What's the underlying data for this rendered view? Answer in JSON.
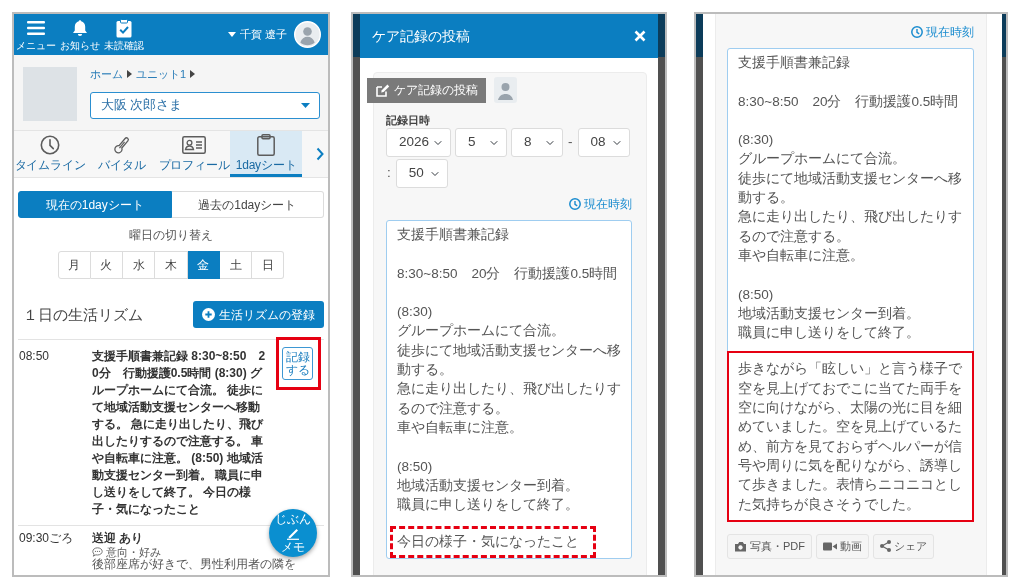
{
  "sheet_screen": {
    "header": {
      "nav_items": [
        {
          "kind": "menu",
          "label": "メニュー"
        },
        {
          "kind": "bell",
          "label": "お知らせ"
        },
        {
          "kind": "unread",
          "label": "未読確認"
        }
      ],
      "user_name": "千賀 遼子"
    },
    "breadcrumb": [
      "ホーム",
      "ユニット1"
    ],
    "resident_select": {
      "value": "大阪 次郎さま"
    },
    "tabs": [
      {
        "kind": "timeline",
        "label": "タイムライン",
        "selected": false
      },
      {
        "kind": "vital",
        "label": "バイタル",
        "selected": false
      },
      {
        "kind": "profile",
        "label": "プロフィール",
        "selected": false
      },
      {
        "kind": "sheet",
        "label": "1dayシート",
        "selected": true
      }
    ],
    "sheet_toggle": [
      {
        "label": "現在の1dayシート",
        "selected": true
      },
      {
        "label": "過去の1dayシート",
        "selected": false
      }
    ],
    "weekday_title": "曜日の切り替え",
    "weekdays": [
      {
        "label": "月",
        "selected": false
      },
      {
        "label": "火",
        "selected": false
      },
      {
        "label": "水",
        "selected": false
      },
      {
        "label": "木",
        "selected": false
      },
      {
        "label": "金",
        "selected": true
      },
      {
        "label": "土",
        "selected": false
      },
      {
        "label": "日",
        "selected": false
      }
    ],
    "section_title": "１日の生活リズム",
    "add_button": "生活リズムの登録",
    "rows": [
      {
        "time": "08:50",
        "title": "支援手順書兼記録 8:30~8:50　20分　行動援護0.5時間 (8:30) グループホームにて合流。 徒歩にて地域活動支援センターへ移動する。 急に走り出したり、飛び出したりするので注意する。 車や自転車に注意。 (8:50) 地域活動支援センター到着。 職員に申し送りをして終了。 今日の様子・気になったこと",
        "record_button": "記録する",
        "highlighted": true
      },
      {
        "time": "09:30ごろ",
        "title": "送迎 あり",
        "note_label": "意向・好み",
        "note": "後部座席が好きで、男性利用者の隣を",
        "highlighted": false
      }
    ],
    "memo_button": {
      "top_text": "じぶん",
      "bottom_text": "メモ"
    }
  },
  "post_screen": {
    "modal_title": "ケア記録の投稿",
    "post_tab": "ケア記録の投稿",
    "datetime_label": "記録日時",
    "datetime_parts": [
      {
        "kind": "select",
        "value": "2026"
      },
      {
        "kind": "select",
        "value": "5"
      },
      {
        "kind": "select",
        "value": "8"
      },
      {
        "kind": "separator",
        "text": "-"
      },
      {
        "kind": "select",
        "value": "08"
      },
      {
        "kind": "separator",
        "text": ":"
      },
      {
        "kind": "select",
        "value": "50"
      }
    ],
    "now_link": "現在時刻",
    "textarea": {
      "paragraphs": [
        [
          "支援手順書兼記録"
        ],
        [
          "8:30~8:50　20分　行動援護0.5時間"
        ],
        [
          "(8:30)",
          "グループホームにて合流。",
          "徒歩にて地域活動支援センターへ移動する。",
          "急に走り出したり、飛び出したりするので注意する。",
          "車や自転車に注意。"
        ],
        [
          "(8:50)",
          "地域活動支援センター到着。",
          "職員に申し送りをして終了。"
        ]
      ],
      "note": {
        "text": "今日の様子・気になったこと",
        "dashed": true
      }
    }
  },
  "post_screen_scrolled": {
    "now_link": "現在時刻",
    "textarea": {
      "paragraphs": [
        [
          "支援手順書兼記録"
        ],
        [
          "8:30~8:50　20分　行動援護0.5時間"
        ],
        [
          "(8:30)",
          "グループホームにて合流。",
          "徒歩にて地域活動支援センターへ移動する。",
          "急に走り出したり、飛び出したりするので注意する。",
          "車や自転車に注意。"
        ],
        [
          "(8:50)",
          "地域活動支援センター到着。",
          "職員に申し送りをして終了。"
        ]
      ],
      "note": {
        "text": "歩きながら「眩しい」と言う様子で空を見上げておでこに当てた両手を空に向けながら、太陽の光に目を細めていました。空を見上げているため、前方を見ておらずヘルパーが信号や周りに気を配りながら、誘導して歩きました。表情らニコニコとした気持ちが良さそうでした。",
        "dashed": false
      }
    },
    "attach_buttons": [
      {
        "kind": "photo",
        "label": "写真・PDF"
      },
      {
        "kind": "video",
        "label": "動画"
      },
      {
        "kind": "share",
        "label": "シェア"
      }
    ]
  }
}
